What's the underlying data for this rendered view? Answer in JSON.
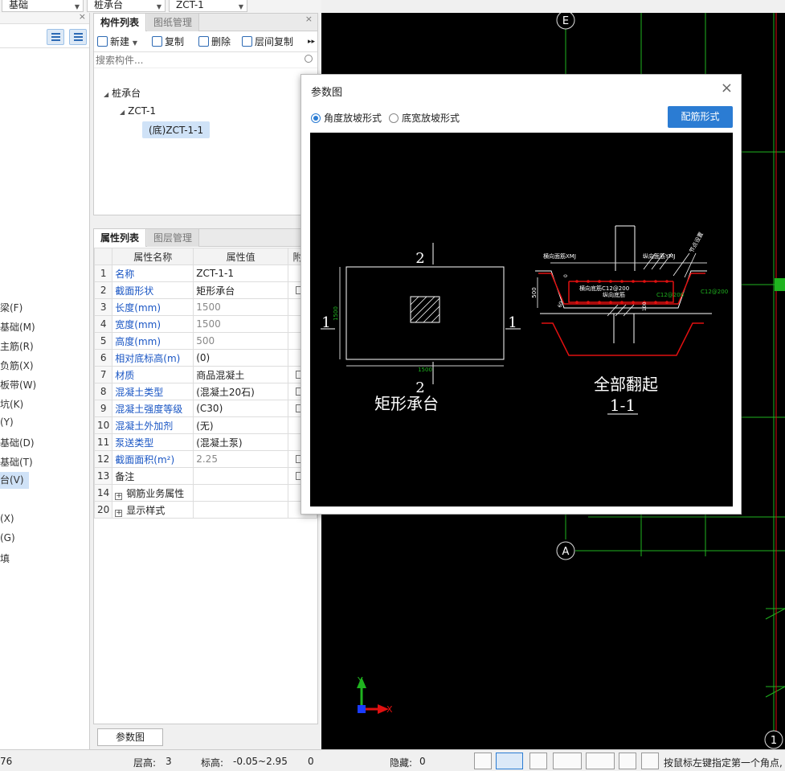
{
  "top_dropdowns": [
    {
      "value": "基础"
    },
    {
      "value": "桩承台"
    },
    {
      "value": "ZCT-1"
    }
  ],
  "left_panel": {
    "items": [
      "梁(F)",
      "基础(M)",
      "主筋(R)",
      "负筋(X)",
      "板带(W)",
      "坑(K)",
      "(Y)",
      "基础(D)",
      "基础(T)",
      "台(V)",
      "(X)",
      "(G)",
      "填"
    ]
  },
  "component_panel": {
    "tabs": [
      "构件列表",
      "图纸管理"
    ],
    "toolbar": {
      "new": "新建",
      "copy": "复制",
      "delete": "删除",
      "floor_copy": "层间复制"
    },
    "search_placeholder": "搜索构件...",
    "tree": {
      "root": "桩承台",
      "child": "ZCT-1",
      "leaf": "(底)ZCT-1-1"
    }
  },
  "property_panel": {
    "tabs": [
      "属性列表",
      "图层管理"
    ],
    "headers": {
      "name": "属性名称",
      "value": "属性值",
      "attach": "附加"
    },
    "rows": [
      {
        "no": "1",
        "name": "名称",
        "value": "ZCT-1-1"
      },
      {
        "no": "2",
        "name": "截面形状",
        "value": "矩形承台"
      },
      {
        "no": "3",
        "name": "长度(mm)",
        "value": "1500"
      },
      {
        "no": "4",
        "name": "宽度(mm)",
        "value": "1500"
      },
      {
        "no": "5",
        "name": "高度(mm)",
        "value": "500"
      },
      {
        "no": "6",
        "name": "相对底标高(m)",
        "value": "(0)"
      },
      {
        "no": "7",
        "name": "材质",
        "value": "商品混凝土"
      },
      {
        "no": "8",
        "name": "混凝土类型",
        "value": "(混凝土20石)"
      },
      {
        "no": "9",
        "name": "混凝土强度等级",
        "value": "(C30)"
      },
      {
        "no": "10",
        "name": "混凝土外加剂",
        "value": "(无)"
      },
      {
        "no": "11",
        "name": "泵送类型",
        "value": "(混凝土泵)"
      },
      {
        "no": "12",
        "name": "截面面积(m²)",
        "value": "2.25"
      },
      {
        "no": "13",
        "name": "备注",
        "value": ""
      },
      {
        "no": "14",
        "name": "钢筋业务属性",
        "value": ""
      },
      {
        "no": "20",
        "name": "显示样式",
        "value": ""
      }
    ]
  },
  "param_button": "参数图",
  "dialog": {
    "title": "参数图",
    "radio_angle": "角度放坡形式",
    "radio_width": "底宽放坡形式",
    "rebar_button": "配筋形式",
    "drawing": {
      "plan_label": "矩形承台",
      "section_label": "全部翻起",
      "section_name": "1-1",
      "mark_1": "1",
      "mark_2": "2",
      "dim_length": "1500",
      "dim_width": "1500",
      "dim_height": "500",
      "bar_top_x": "横向面筋XMJ",
      "bar_top_y": "纵向面筋YMJ",
      "bar_bot_x": "横向底筋C12@200",
      "bar_bot_y": "纵向底筋",
      "bar_bot_y_val": "C12@200",
      "bar_side_val": "C12@200",
      "side_note": "节点设置",
      "dim_100": "100",
      "dim_60": "60",
      "dim_0": "0"
    }
  },
  "cad": {
    "axis_e": "E",
    "axis_a": "A",
    "axis_1": "1",
    "x_label": "X",
    "y_label": "Y"
  },
  "status_bar": {
    "coord": "76",
    "floor_label": "层高:",
    "floor_value": "3",
    "elev_label": "标高:",
    "elev_value": "-0.05~2.95",
    "zero": "0",
    "hidden_label": "隐藏:",
    "hidden_value": "0",
    "hint": "按鼠标左键指定第一个角点,"
  },
  "colors": {
    "accent": "#2b7cd3",
    "link_blue": "#1a56c4",
    "cad_green": "#1fb31f",
    "cad_red": "#e01010"
  }
}
